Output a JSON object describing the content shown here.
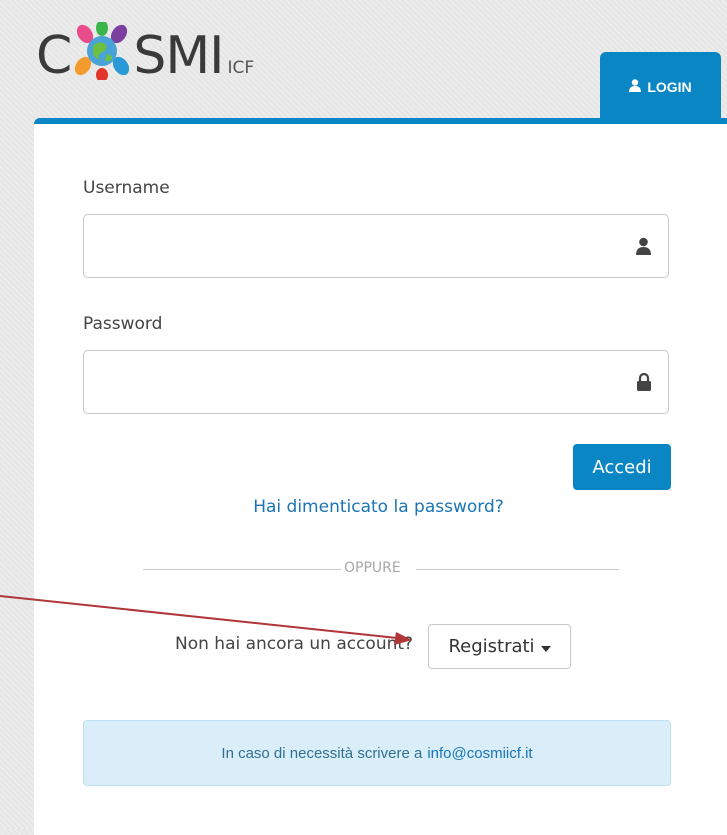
{
  "brand": {
    "logo_left": "C",
    "logo_right": "SMI",
    "logo_suffix": "ICF"
  },
  "tab": {
    "login_label": "LOGIN",
    "icon": "user-icon"
  },
  "form": {
    "username_label": "Username",
    "username_value": "",
    "username_icon": "user-icon",
    "password_label": "Password",
    "password_value": "",
    "password_icon": "lock-icon",
    "submit_label": "Accedi",
    "forgot_link": "Hai dimenticato la password?"
  },
  "separator": {
    "label": "OPPURE"
  },
  "register": {
    "prompt": "Non hai ancora un account?",
    "button_label": "Registrati",
    "caret_icon": "caret-down-icon"
  },
  "info": {
    "text": "In caso di necessità scrivere a",
    "email": "info@cosmiicf.it"
  },
  "colors": {
    "primary": "#0a86c5",
    "link": "#1a74b6",
    "info_bg": "#d9eef8",
    "annotation_arrow": "#b0363a"
  }
}
